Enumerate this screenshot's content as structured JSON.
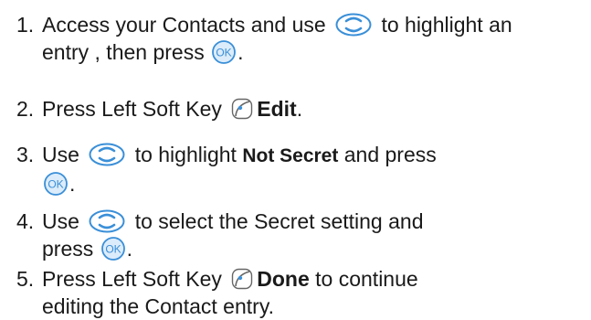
{
  "steps": [
    {
      "number": "1.",
      "part1": "Access your Contacts and use",
      "part2": "to highlight an",
      "part3": "entry , then press",
      "part4": "."
    },
    {
      "number": "2.",
      "part1": "Press Left Soft Key",
      "bold": "Edit",
      "part2": "."
    },
    {
      "number": "3.",
      "part1": "Use",
      "part2": "to highlight",
      "bold": "Not Secret",
      "part3": "and press",
      "part4": "."
    },
    {
      "number": "4.",
      "part1": "Use",
      "part2": "to select the Secret setting and",
      "part3": "press",
      "part4": "."
    },
    {
      "number": "5.",
      "part1": "Press Left Soft Key",
      "bold": "Done",
      "part2": "to continue",
      "part3": "editing the Contact entry."
    }
  ],
  "icons": {
    "nav_key": "navigation-key-icon",
    "ok_key": "ok-key-icon",
    "soft_key": "left-soft-key-icon",
    "ok_label": "OK",
    "key_color": "#3a8fd8",
    "key_fill": "#dcecfa"
  }
}
